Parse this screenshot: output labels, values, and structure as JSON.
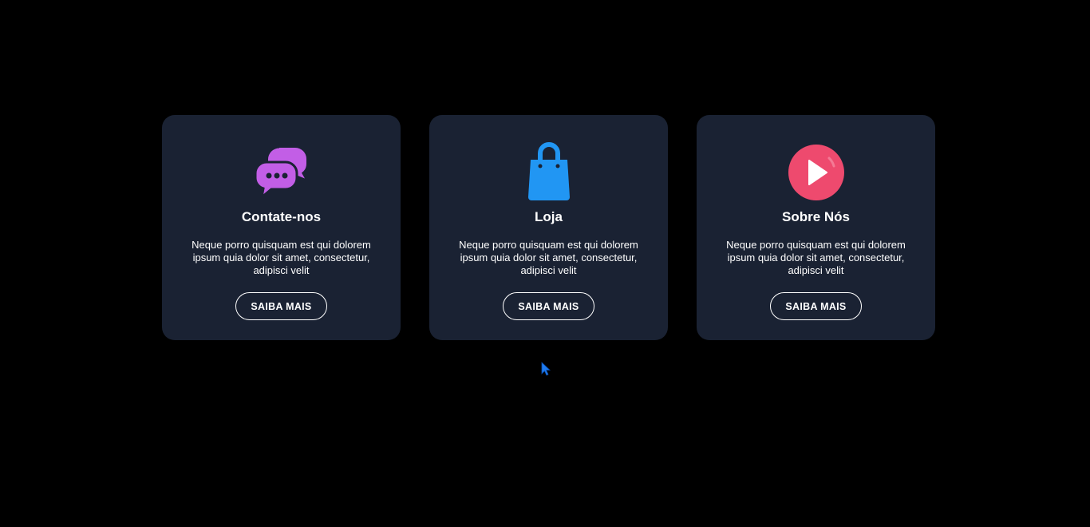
{
  "cards": [
    {
      "icon": "chat-bubbles-icon",
      "icon_color": "#c25ee6",
      "title": "Contate-nos",
      "description": "Neque porro quisquam est qui dolorem ipsum quia dolor sit amet, consectetur, adipisci velit",
      "button_label": "SAIBA MAIS"
    },
    {
      "icon": "shopping-bag-icon",
      "icon_color": "#2196f3",
      "title": "Loja",
      "description": "Neque porro quisquam est qui dolorem ipsum quia dolor sit amet, consectetur, adipisci velit",
      "button_label": "SAIBA MAIS"
    },
    {
      "icon": "play-circle-icon",
      "icon_color": "#ee4a6e",
      "title": "Sobre Nós",
      "description": "Neque porro quisquam est qui dolorem ipsum quia dolor sit amet, consectetur, adipisci velit",
      "button_label": "SAIBA MAIS"
    }
  ],
  "colors": {
    "background": "#000000",
    "card_background": "#1a2233",
    "text": "#ffffff",
    "cursor": "#1e7bf0"
  }
}
